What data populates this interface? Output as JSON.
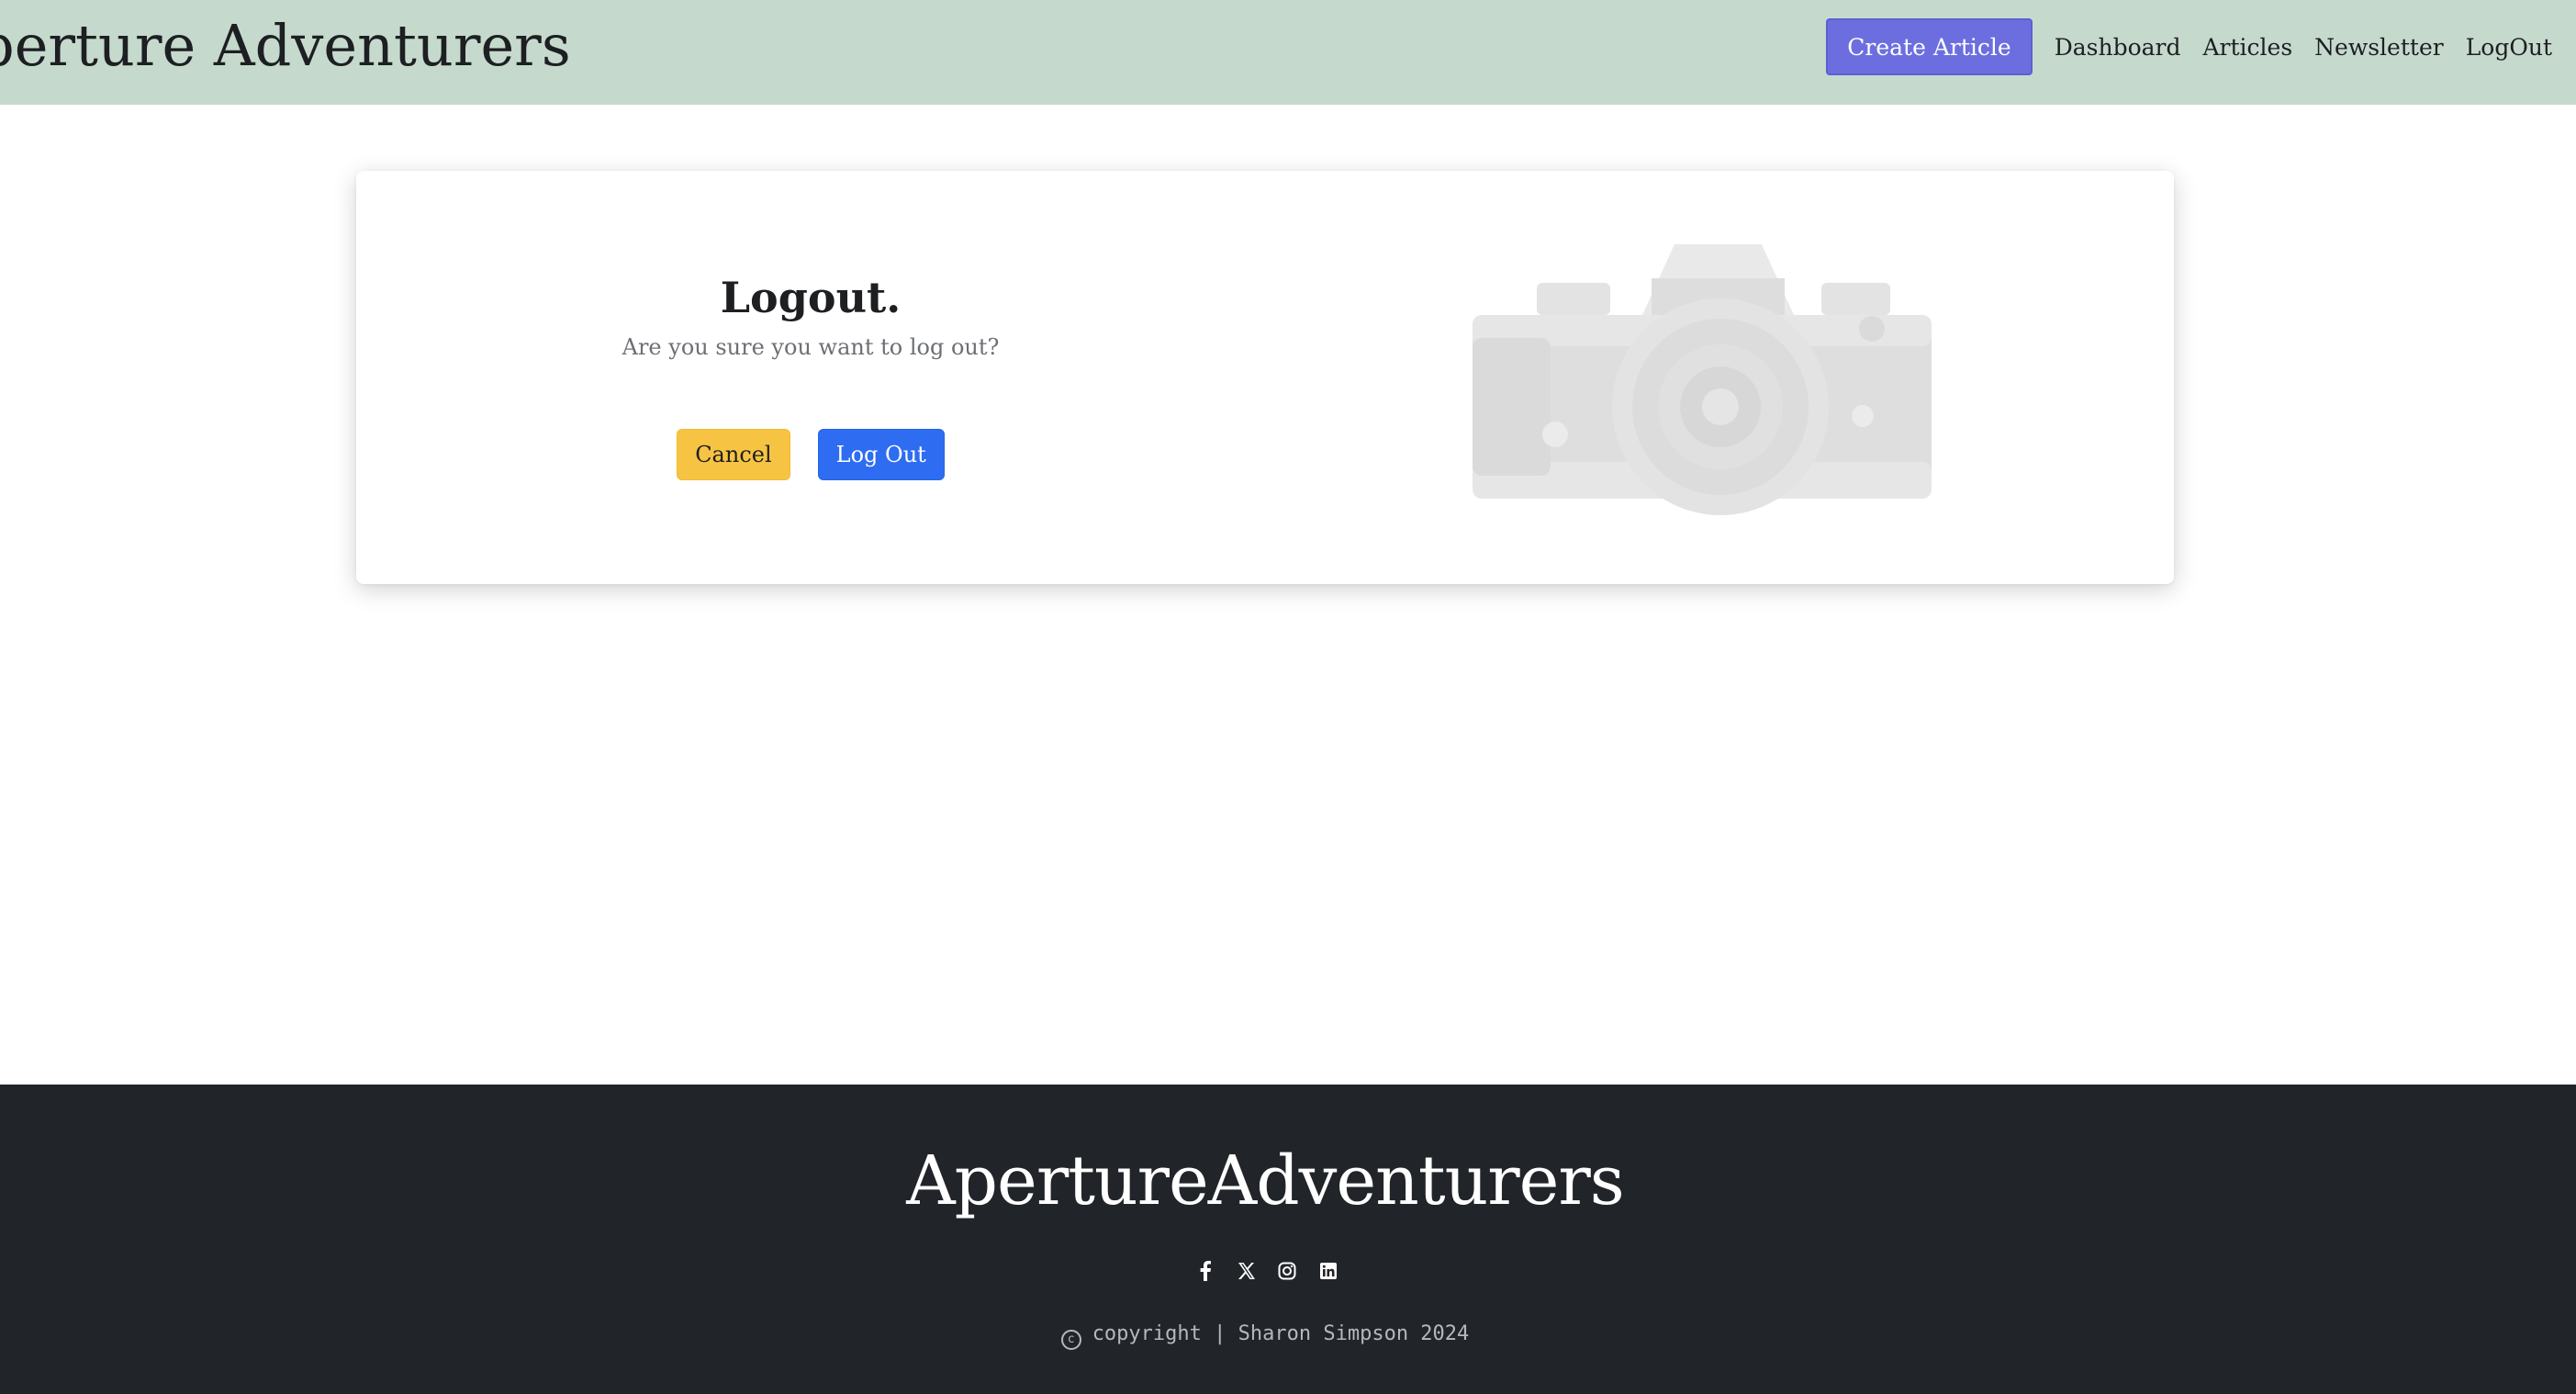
{
  "navbar": {
    "brand": "perture Adventurers",
    "create_button": "Create Article",
    "links": [
      "Dashboard",
      "Articles",
      "Newsletter",
      "LogOut"
    ]
  },
  "card": {
    "title": "Logout.",
    "subtitle": "Are you sure you want to log out?",
    "cancel_label": "Cancel",
    "logout_label": "Log Out",
    "image_alt": "camera-image"
  },
  "footer": {
    "brand": "ApertureAdventurers",
    "socials": [
      "facebook-icon",
      "x-twitter-icon",
      "instagram-icon",
      "linkedin-icon"
    ],
    "copyright": "copyright | Sharon Simpson 2024"
  },
  "colors": {
    "navbar_bg": "#c5dacd",
    "create_button_bg": "#6c6ee0",
    "cancel_bg": "#f7c342",
    "logout_bg": "#2e6cf2",
    "footer_bg": "#212429"
  }
}
